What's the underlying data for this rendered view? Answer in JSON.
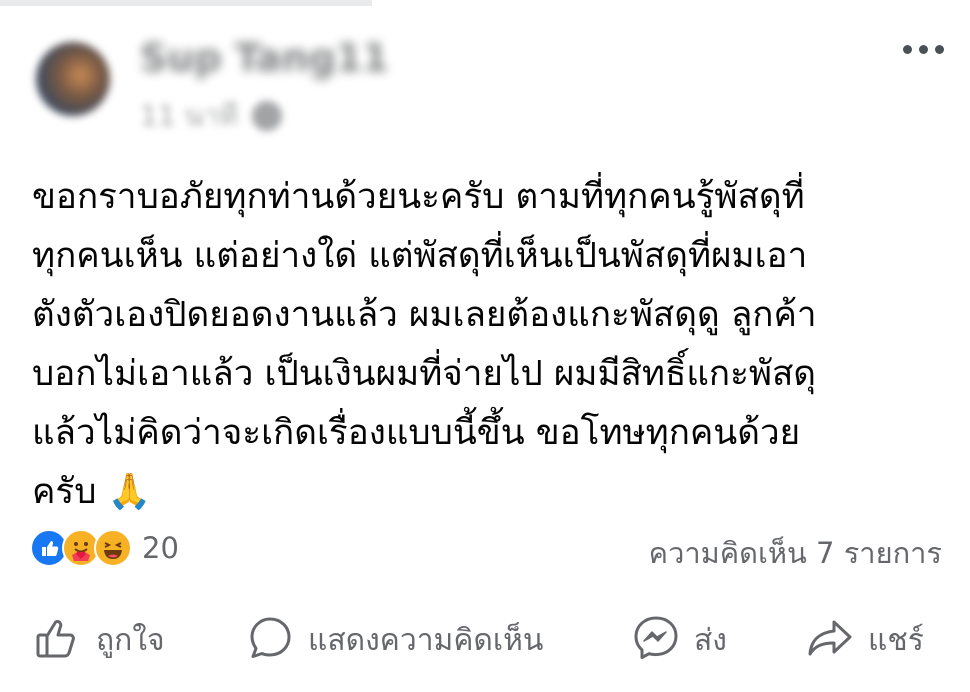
{
  "post": {
    "text": "ขอกราบอภัยทุกท่านด้วยนะครับ ตามที่ทุกคนรู้พัสดุที่\nทุกคนเห็น แต่อย่างใด่ แต่พัสดุที่เห็นเป็นพัสดุที่ผมเอา\nตังตัวเองปิดยอดงานแล้ว ผมเลยต้องแกะพัสดุดู ลูกค้า\nบอกไม่เอาแล้ว เป็นเงินผมที่จ่ายไป ผมมีสิทธิ์แกะพัสดุ\nแล้วไม่คิดว่าจะเกิดเรื่องแบบนี้ขึ้น  ขอโทษทุกคนด้วย\nครับ 🙏"
  },
  "reactions": {
    "types": [
      "like",
      "care",
      "haha"
    ],
    "count": "20",
    "comments": "ความคิดเห็น 7 รายการ"
  },
  "actions": {
    "like": "ถูกใจ",
    "comment": "แสดงความคิดเห็น",
    "send": "ส่ง",
    "share": "แชร์"
  },
  "colors": {
    "like_blue": "#1877f2",
    "secondary_text": "#65676b",
    "icon_gray": "#4b4f56"
  },
  "icons": {
    "more": "more-horizontal-icon",
    "like": "thumbs-up-icon",
    "comment": "speech-bubble-icon",
    "send": "messenger-icon",
    "share": "share-arrow-icon"
  }
}
